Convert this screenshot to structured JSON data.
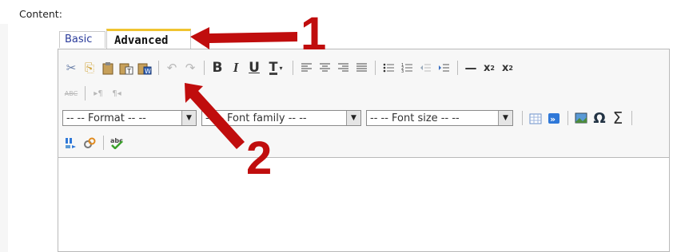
{
  "content_label": "Content:",
  "tabs": [
    {
      "label": "Basic",
      "active": false
    },
    {
      "label": "Advanced",
      "active": true
    }
  ],
  "toolbar": {
    "row1": [
      {
        "name": "cut-icon",
        "glyph": "✂",
        "enabled": true
      },
      {
        "name": "copy-icon",
        "glyph": "⎘",
        "enabled": true
      },
      {
        "name": "paste-icon",
        "glyph": "📋",
        "enabled": true
      },
      {
        "name": "paste-text-icon",
        "glyph": "📋",
        "enabled": true
      },
      {
        "name": "paste-word-icon",
        "glyph": "📋",
        "enabled": true
      },
      {
        "name": "undo-icon",
        "glyph": "↶",
        "enabled": false
      },
      {
        "name": "redo-icon",
        "glyph": "↷",
        "enabled": false
      },
      {
        "name": "bold-icon",
        "glyph": "B",
        "enabled": true
      },
      {
        "name": "italic-icon",
        "glyph": "I",
        "enabled": true
      },
      {
        "name": "underline-icon",
        "glyph": "U",
        "enabled": true
      },
      {
        "name": "text-color-icon",
        "glyph": "T",
        "enabled": true
      },
      {
        "name": "align-left-icon",
        "glyph": "≡",
        "enabled": true
      },
      {
        "name": "align-center-icon",
        "glyph": "≡",
        "enabled": true
      },
      {
        "name": "align-right-icon",
        "glyph": "≡",
        "enabled": true
      },
      {
        "name": "justify-icon",
        "glyph": "≣",
        "enabled": true
      },
      {
        "name": "bullet-list-icon",
        "glyph": "☰",
        "enabled": true
      },
      {
        "name": "numbered-list-icon",
        "glyph": "☷",
        "enabled": true
      },
      {
        "name": "outdent-icon",
        "glyph": "⇤",
        "enabled": false
      },
      {
        "name": "indent-icon",
        "glyph": "⇥",
        "enabled": true
      },
      {
        "name": "horizontal-rule-icon",
        "glyph": "—",
        "enabled": true
      },
      {
        "name": "subscript-icon",
        "glyph": "x₂",
        "enabled": true
      },
      {
        "name": "superscript-icon",
        "glyph": "x²",
        "enabled": true
      }
    ],
    "row2": [
      {
        "name": "strikethrough-icon",
        "glyph": "ABC",
        "enabled": false
      },
      {
        "name": "ltr-icon",
        "glyph": "▸¶",
        "enabled": false
      },
      {
        "name": "rtl-icon",
        "glyph": "¶◂",
        "enabled": false
      }
    ],
    "selects": {
      "format": "-- -- Format -- --",
      "font_family": "-- -- Font family -- --",
      "font_size": "-- -- Font size -- --"
    },
    "row3_icons": [
      {
        "name": "table-icon",
        "glyph": "▦",
        "enabled": true
      },
      {
        "name": "next-icon",
        "glyph": "»",
        "enabled": true
      },
      {
        "name": "image-icon",
        "glyph": "▣",
        "enabled": true
      },
      {
        "name": "omega-icon",
        "glyph": "Ω",
        "enabled": true
      },
      {
        "name": "sigma-icon",
        "glyph": "Σ",
        "enabled": true
      }
    ],
    "row4": [
      {
        "name": "media-icon",
        "glyph": "▶",
        "enabled": true
      },
      {
        "name": "link-icon",
        "glyph": "⚭",
        "enabled": true
      },
      {
        "name": "spellcheck-icon",
        "glyph": "✔",
        "enabled": true
      }
    ]
  },
  "annotations": [
    "1",
    "2"
  ],
  "colors": {
    "arrow": "#c00d0d",
    "tab_active_border": "#f0c430",
    "link_blue": "#2a3b9a"
  }
}
